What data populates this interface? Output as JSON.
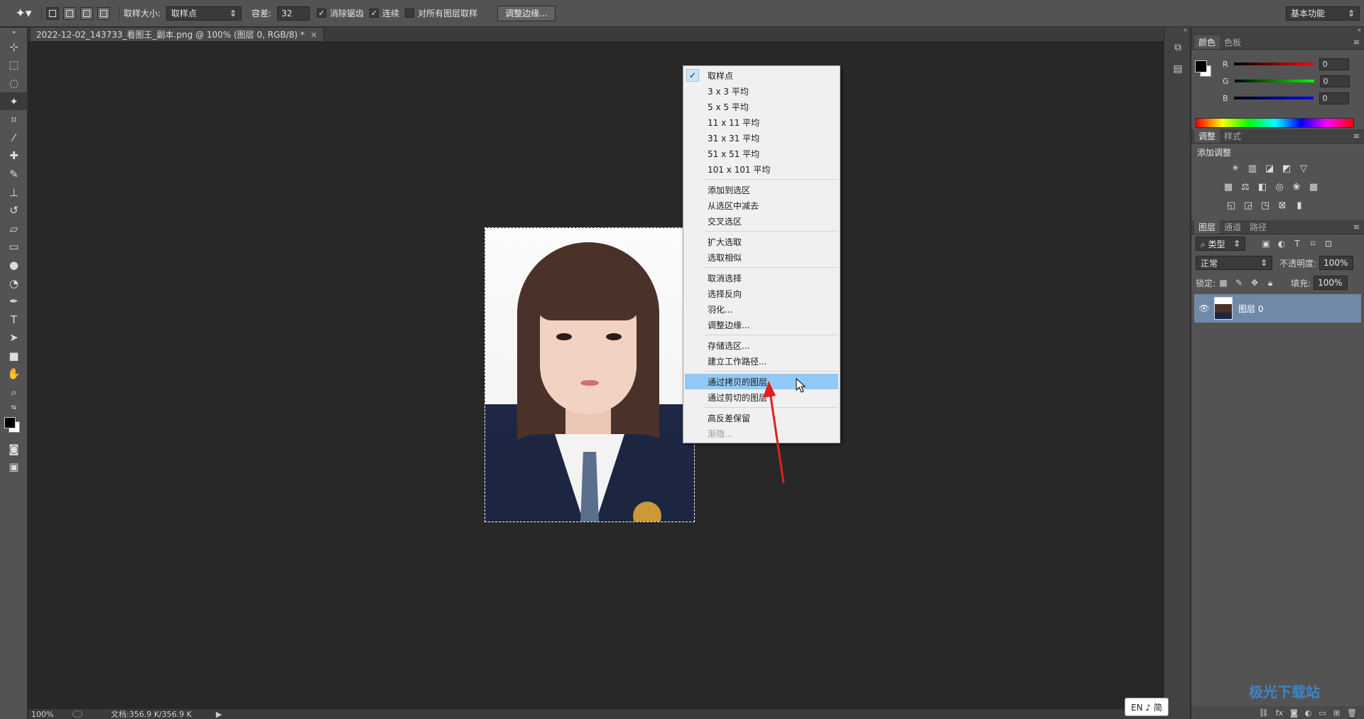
{
  "options_bar": {
    "tool_icon": "magic-wand-icon",
    "sample_size_label": "取样大小:",
    "sample_size_value": "取样点",
    "tolerance_label": "容差:",
    "tolerance_value": "32",
    "antialias_label": "消除锯齿",
    "antialias_checked": true,
    "contiguous_label": "连续",
    "contiguous_checked": true,
    "sample_all_label": "对所有图层取样",
    "sample_all_checked": false,
    "refine_edge_button": "调整边缘...",
    "workspace": "基本功能"
  },
  "document": {
    "tab_title": "2022-12-02_143733_看图王_副本.png @ 100% (图层 0, RGB/8) *",
    "close": "×"
  },
  "status_bar": {
    "zoom": "100%",
    "doc_size": "文档:356.9 K/356.9 K"
  },
  "context_menu": {
    "groups": [
      [
        {
          "label": "取样点",
          "checked": true
        },
        {
          "label": "3 x 3 平均"
        },
        {
          "label": "5 x 5 平均"
        },
        {
          "label": "11 x 11 平均"
        },
        {
          "label": "31 x 31 平均"
        },
        {
          "label": "51 x 51 平均"
        },
        {
          "label": "101 x 101 平均"
        }
      ],
      [
        {
          "label": "添加到选区"
        },
        {
          "label": "从选区中减去"
        },
        {
          "label": "交叉选区"
        }
      ],
      [
        {
          "label": "扩大选取"
        },
        {
          "label": "选取相似"
        }
      ],
      [
        {
          "label": "取消选择"
        },
        {
          "label": "选择反向"
        },
        {
          "label": "羽化..."
        },
        {
          "label": "调整边缘..."
        }
      ],
      [
        {
          "label": "存储选区..."
        },
        {
          "label": "建立工作路径..."
        }
      ],
      [
        {
          "label": "通过拷贝的图层",
          "highlighted": true
        },
        {
          "label": "通过剪切的图层"
        }
      ],
      [
        {
          "label": "高反差保留"
        },
        {
          "label": "渐隐...",
          "disabled": true
        }
      ]
    ]
  },
  "color_panel": {
    "tabs": [
      "颜色",
      "色板"
    ],
    "channels": [
      {
        "name": "R",
        "value": "0",
        "color": "#e03030"
      },
      {
        "name": "G",
        "value": "0",
        "color": "#30c030"
      },
      {
        "name": "B",
        "value": "0",
        "color": "#3050e0"
      }
    ]
  },
  "adjustments_panel": {
    "tabs": [
      "调整",
      "样式"
    ],
    "title": "添加调整"
  },
  "layers_panel": {
    "tabs": [
      "图层",
      "通道",
      "路径"
    ],
    "filter_kind": "类型",
    "blend_mode": "正常",
    "opacity_label": "不透明度:",
    "opacity_value": "100%",
    "lock_label": "锁定:",
    "fill_label": "填充:",
    "fill_value": "100%",
    "layers": [
      {
        "name": "图层 0",
        "visible": true,
        "selected": true
      }
    ]
  },
  "ime": {
    "text": "EN ♪ 简"
  },
  "watermark": "极光下载站",
  "colors": {
    "accent": "#91c9f7",
    "arrow": "#e02020"
  }
}
